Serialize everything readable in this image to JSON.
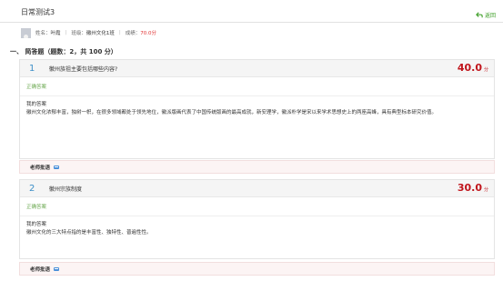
{
  "header": {
    "title": "日常测试3",
    "return_label": "返回"
  },
  "student": {
    "name_label": "姓名：",
    "name": "叶霞",
    "class_label": "班级：",
    "class_name": "徽州文化1班",
    "score_label": "成绩：",
    "score": "70.0分"
  },
  "section": {
    "title": "一、 简答题（题数：2，共 100 分）"
  },
  "questions": [
    {
      "number": "1",
      "text": "徽州族祖主要包括哪些内容?",
      "score": "40.0",
      "score_unit": "分",
      "correct_label": "正确答案",
      "my_answer_label": "我的答案",
      "my_answer": "徽州文化浓郁丰富，独树一帜，在很多领域都处于领先地位，徽派版画代表了中国传统版画的最高成就，新安理学，徽派朴学是宋以来学术思想史上的两座高峰，具有典型标本研究价值。",
      "teacher_label": "老师批语"
    },
    {
      "number": "2",
      "text": "徽州宗族制度",
      "score": "30.0",
      "score_unit": "分",
      "correct_label": "正确答案",
      "my_answer_label": "我的答案",
      "my_answer": "徽州文化的三大特点指的是丰富性、独特性、普遍性性。",
      "teacher_label": "老师批语"
    }
  ],
  "colors": {
    "accent": "#3d8fc8",
    "score_red": "#c0141b",
    "correct_green": "#6aa84f",
    "return_green": "#3a9d23"
  },
  "icons": {
    "return": "return-arrow-icon",
    "comment": "comment-icon",
    "avatar": "user-avatar-icon"
  }
}
